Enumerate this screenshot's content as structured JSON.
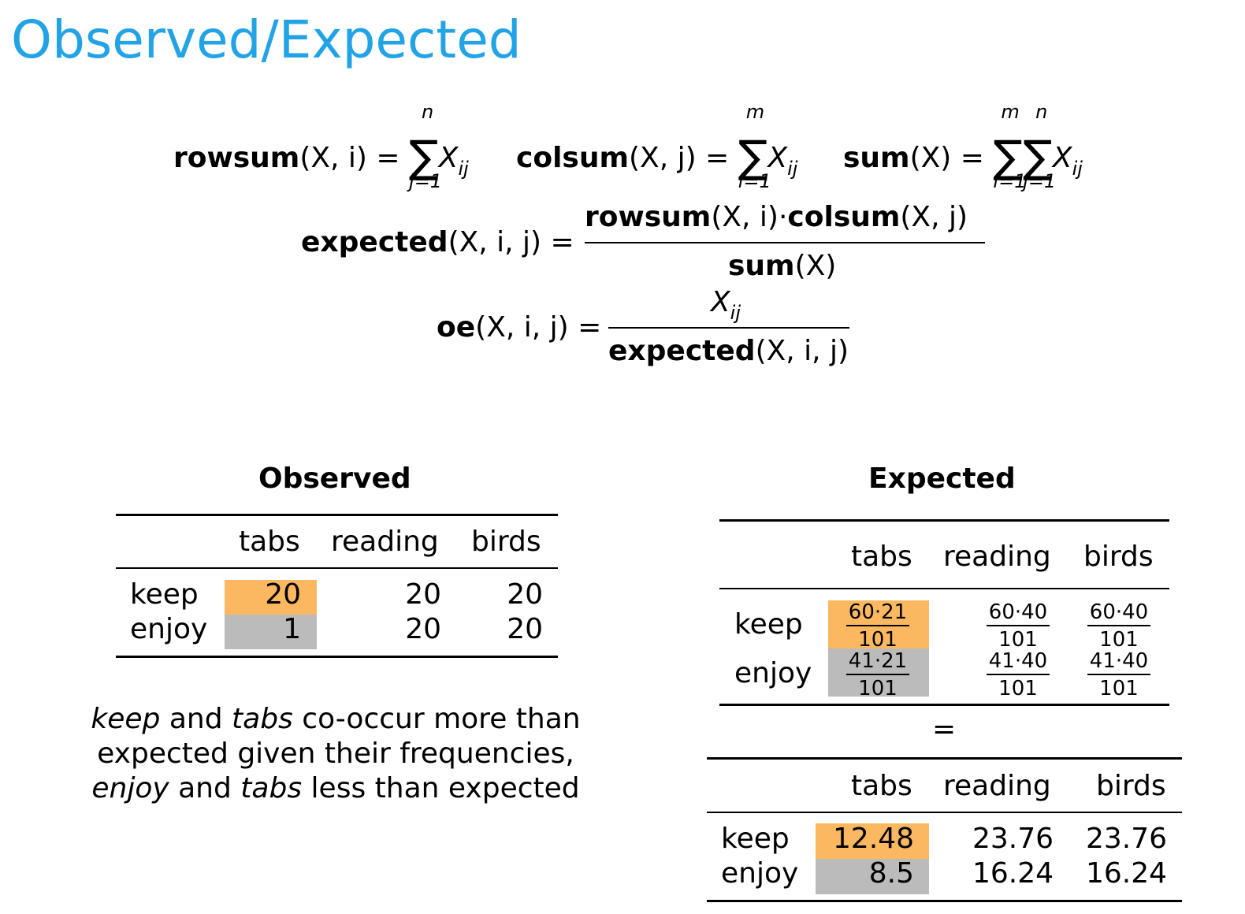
{
  "title": "Observed/Expected",
  "formulas": {
    "rowsum_name": "rowsum",
    "colsum_name": "colsum",
    "sum_name": "sum",
    "expected_name": "expected",
    "oe_name": "oe",
    "rowsum_args": "(X, i)",
    "colsum_args": "(X, j)",
    "sum_args": "(X)",
    "three_args": "(X, i, j)",
    "equals": "=",
    "sum_symbol": "∑",
    "var_X": "X",
    "subscript_ij": "ij",
    "lim_j1": "j=1",
    "lim_i1": "i=1",
    "lim_n": "n",
    "lim_m": "m",
    "dot": "·"
  },
  "observed": {
    "title": "Observed",
    "columns": [
      "tabs",
      "reading",
      "birds"
    ],
    "rows": [
      {
        "label": "keep",
        "values": [
          "20",
          "20",
          "20"
        ]
      },
      {
        "label": "enjoy",
        "values": [
          "1",
          "20",
          "20"
        ]
      }
    ]
  },
  "expected": {
    "title": "Expected",
    "columns": [
      "tabs",
      "reading",
      "birds"
    ],
    "fraction_rows": [
      {
        "label": "keep",
        "cells": [
          {
            "num": "60·21",
            "den": "101"
          },
          {
            "num": "60·40",
            "den": "101"
          },
          {
            "num": "60·40",
            "den": "101"
          }
        ]
      },
      {
        "label": "enjoy",
        "cells": [
          {
            "num": "41·21",
            "den": "101"
          },
          {
            "num": "41·40",
            "den": "101"
          },
          {
            "num": "41·40",
            "den": "101"
          }
        ]
      }
    ],
    "equals": "=",
    "result_columns": [
      "tabs",
      "reading",
      "birds"
    ],
    "result_rows": [
      {
        "label": "keep",
        "values": [
          "12.48",
          "23.76",
          "23.76"
        ]
      },
      {
        "label": "enjoy",
        "values": [
          "8.5",
          "16.24",
          "16.24"
        ]
      }
    ]
  },
  "note": {
    "line1_a": "keep",
    "line1_b": " and ",
    "line1_c": "tabs",
    "line1_d": " co-occur more than",
    "line2": "expected given their frequencies,",
    "line3_a": "enjoy",
    "line3_b": " and ",
    "line3_c": "tabs",
    "line3_d": " less than expected"
  },
  "colors": {
    "title": "#22a3e6",
    "highlight_high": "#fcb860",
    "highlight_low": "#bbbbbb"
  }
}
